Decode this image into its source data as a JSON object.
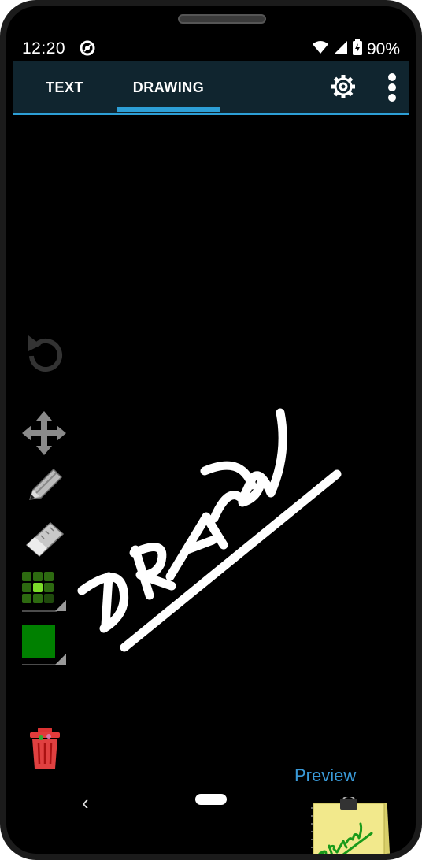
{
  "status_bar": {
    "time": "12:20",
    "battery": "90%",
    "icons": [
      "do-not-disturb-icon",
      "wifi-icon",
      "signal-icon",
      "battery-icon"
    ]
  },
  "tabs": [
    {
      "label": "TEXT",
      "selected": false
    },
    {
      "label": "DRAWING",
      "selected": true
    }
  ],
  "toolbar": {
    "icons": [
      "settings-icon",
      "more-options-icon"
    ]
  },
  "tools": {
    "icons": [
      "undo-icon",
      "move-icon",
      "pencil-icon",
      "eraser-icon",
      "brush-size-icon",
      "color-swatch-icon",
      "trash-icon"
    ],
    "color": "#008000"
  },
  "drawing": {
    "text": "DRAW"
  },
  "preview": {
    "label": "Preview"
  },
  "colors": {
    "accent": "#2d9fd6",
    "appbar": "#10252f",
    "preview_label": "#3a9ad8"
  }
}
